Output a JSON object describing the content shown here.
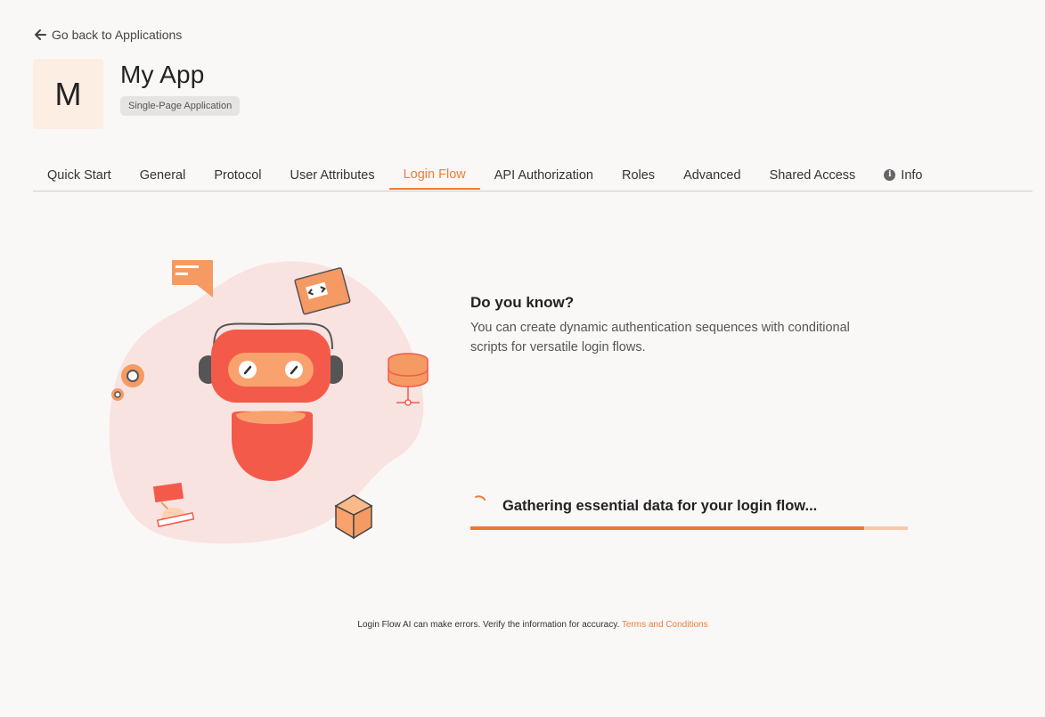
{
  "nav": {
    "back_label": "Go back to Applications"
  },
  "app": {
    "avatar_letter": "M",
    "name": "My App",
    "type_badge": "Single-Page Application"
  },
  "tabs": [
    {
      "label": "Quick Start"
    },
    {
      "label": "General"
    },
    {
      "label": "Protocol"
    },
    {
      "label": "User Attributes"
    },
    {
      "label": "Login Flow",
      "active": true
    },
    {
      "label": "API Authorization"
    },
    {
      "label": "Roles"
    },
    {
      "label": "Advanced"
    },
    {
      "label": "Shared Access"
    },
    {
      "label": "Info",
      "icon": "info-icon"
    }
  ],
  "tip": {
    "heading": "Do you know?",
    "body": "You can create dynamic authentication sequences with conditional scripts for versatile login flows."
  },
  "progress": {
    "label": "Gathering essential data for your login flow...",
    "fraction": 0.9
  },
  "footer": {
    "disclaimer": "Login Flow AI can make errors. Verify the information for accuracy.",
    "link_label": "Terms and Conditions"
  },
  "colors": {
    "accent": "#f07c3a",
    "background": "#faf8f7"
  }
}
